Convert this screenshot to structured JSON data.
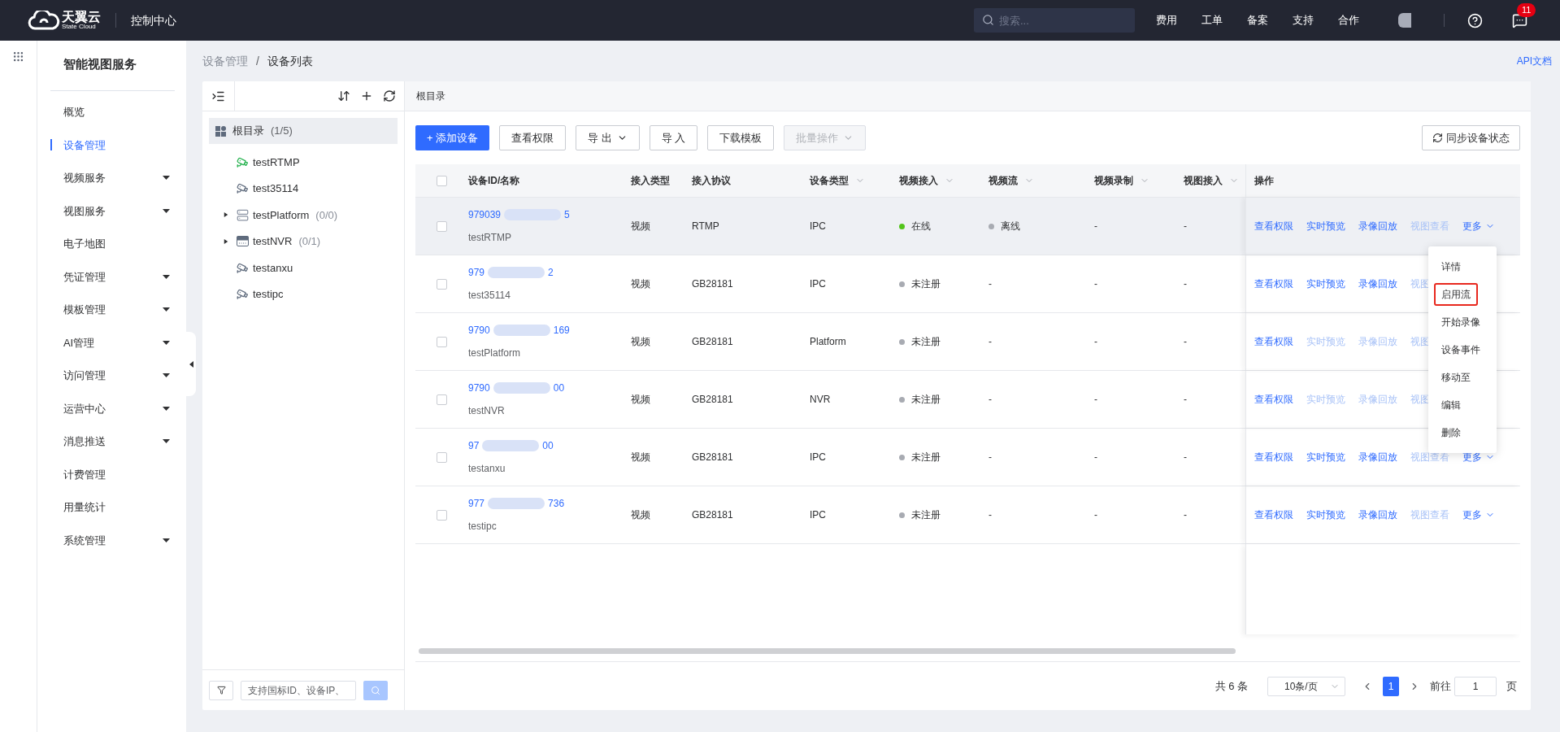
{
  "header": {
    "brand": "天翼云",
    "brand_sub": "State Cloud",
    "console": "控制中心",
    "search": {
      "placeholder": "搜索..."
    },
    "nav": [
      "费用",
      "工单",
      "备案",
      "支持",
      "合作"
    ],
    "badge": "11"
  },
  "sidebar": {
    "title": "智能视图服务",
    "items": [
      {
        "label": "概览",
        "selected": false,
        "expandable": false
      },
      {
        "label": "设备管理",
        "selected": true,
        "expandable": false
      },
      {
        "label": "视频服务",
        "selected": false,
        "expandable": true
      },
      {
        "label": "视图服务",
        "selected": false,
        "expandable": true
      },
      {
        "label": "电子地图",
        "selected": false,
        "expandable": false
      },
      {
        "label": "凭证管理",
        "selected": false,
        "expandable": true
      },
      {
        "label": "模板管理",
        "selected": false,
        "expandable": true
      },
      {
        "label": "AI管理",
        "selected": false,
        "expandable": true
      },
      {
        "label": "访问管理",
        "selected": false,
        "expandable": true
      },
      {
        "label": "运营中心",
        "selected": false,
        "expandable": true
      },
      {
        "label": "消息推送",
        "selected": false,
        "expandable": true
      },
      {
        "label": "计费管理",
        "selected": false,
        "expandable": false
      },
      {
        "label": "用量统计",
        "selected": false,
        "expandable": false
      },
      {
        "label": "系统管理",
        "selected": false,
        "expandable": true
      }
    ]
  },
  "breadcrumb": [
    "设备管理",
    "设备列表"
  ],
  "breadcrumb_separator": "/",
  "api_link": "API文档",
  "tree": {
    "root": {
      "label": "根目录",
      "count": "(1/5)",
      "selected": true,
      "children": [
        {
          "label": "testRTMP",
          "kind": "camera",
          "online": true
        },
        {
          "label": "test35114",
          "kind": "camera",
          "online": false
        },
        {
          "label": "testPlatform",
          "kind": "platform",
          "count": "(0/0)",
          "expanded": false
        },
        {
          "label": "testNVR",
          "kind": "nvr",
          "count": "(0/1)",
          "expanded": false
        },
        {
          "label": "testanxu",
          "kind": "camera",
          "online": false
        },
        {
          "label": "testipc",
          "kind": "camera",
          "online": false
        }
      ]
    },
    "search": {
      "placeholder": "支持国标ID、设备IP、"
    }
  },
  "panel_title": "根目录",
  "toolbar": [
    {
      "label": "+ 添加设备",
      "kind": "primary",
      "disabled": false,
      "dropdown": false
    },
    {
      "label": "查看权限",
      "kind": "default",
      "disabled": false,
      "dropdown": false
    },
    {
      "label": "导 出",
      "kind": "default",
      "disabled": false,
      "dropdown": true
    },
    {
      "label": "导 入",
      "kind": "default",
      "disabled": false,
      "dropdown": false
    },
    {
      "label": "下载模板",
      "kind": "default",
      "disabled": false,
      "dropdown": false
    },
    {
      "label": "批量操作",
      "kind": "default",
      "disabled": true,
      "dropdown": true
    }
  ],
  "sync_button": "同步设备状态",
  "table": {
    "select_all_checked": false,
    "columns": [
      {
        "label": "设备ID/名称",
        "filter": false
      },
      {
        "label": "接入类型",
        "filter": false
      },
      {
        "label": "接入协议",
        "filter": false
      },
      {
        "label": "设备类型",
        "filter": true
      },
      {
        "label": "视频接入",
        "filter": true
      },
      {
        "label": "视频流",
        "filter": true
      },
      {
        "label": "视频录制",
        "filter": true
      },
      {
        "label": "视图接入",
        "filter": true
      },
      {
        "label": "操作",
        "filter": false
      }
    ],
    "rows": [
      {
        "id_head": "979039",
        "id_tail": "5",
        "name": "testRTMP",
        "access_type": "视频",
        "protocol": "RTMP",
        "device_type": "IPC",
        "video_access": {
          "text": "在线",
          "color": "#52c41a"
        },
        "video_stream": {
          "text": "离线",
          "color": "#a8abb2"
        },
        "video_recording": "-",
        "view_access": "-",
        "highlighted": true,
        "checked": false,
        "ops": [
          {
            "label": "查看权限",
            "disabled": false
          },
          {
            "label": "实时预览",
            "disabled": false
          },
          {
            "label": "录像回放",
            "disabled": false
          },
          {
            "label": "视图查看",
            "disabled": true
          }
        ],
        "more": "更多"
      },
      {
        "id_head": "979",
        "id_tail": "2",
        "name": "test35114",
        "access_type": "视频",
        "protocol": "GB28181",
        "device_type": "IPC",
        "video_access": {
          "text": "未注册",
          "color": "#a8abb2"
        },
        "video_stream": {
          "text": "-"
        },
        "video_recording": "-",
        "view_access": "-",
        "highlighted": false,
        "checked": false,
        "ops": [
          {
            "label": "查看权限",
            "disabled": false
          },
          {
            "label": "实时预览",
            "disabled": false
          },
          {
            "label": "录像回放",
            "disabled": false
          },
          {
            "label": "视图",
            "disabled": true
          }
        ]
      },
      {
        "id_head": "9790",
        "id_tail": "169",
        "name": "testPlatform",
        "access_type": "视频",
        "protocol": "GB28181",
        "device_type": "Platform",
        "video_access": {
          "text": "未注册",
          "color": "#a8abb2"
        },
        "video_stream": {
          "text": "-"
        },
        "video_recording": "-",
        "view_access": "-",
        "highlighted": false,
        "checked": false,
        "ops": [
          {
            "label": "查看权限",
            "disabled": false
          },
          {
            "label": "实时预览",
            "disabled": true
          },
          {
            "label": "录像回放",
            "disabled": true
          },
          {
            "label": "视图",
            "disabled": true
          }
        ]
      },
      {
        "id_head": "9790",
        "id_tail": "00",
        "name": "testNVR",
        "access_type": "视频",
        "protocol": "GB28181",
        "device_type": "NVR",
        "video_access": {
          "text": "未注册",
          "color": "#a8abb2"
        },
        "video_stream": {
          "text": "-"
        },
        "video_recording": "-",
        "view_access": "-",
        "highlighted": false,
        "checked": false,
        "ops": [
          {
            "label": "查看权限",
            "disabled": false
          },
          {
            "label": "实时预览",
            "disabled": true
          },
          {
            "label": "录像回放",
            "disabled": true
          },
          {
            "label": "视图",
            "disabled": true
          }
        ]
      },
      {
        "id_head": "97",
        "id_tail": "00",
        "name": "testanxu",
        "access_type": "视频",
        "protocol": "GB28181",
        "device_type": "IPC",
        "video_access": {
          "text": "未注册",
          "color": "#a8abb2"
        },
        "video_stream": {
          "text": "-"
        },
        "video_recording": "-",
        "view_access": "-",
        "highlighted": false,
        "checked": false,
        "ops": [
          {
            "label": "查看权限",
            "disabled": false
          },
          {
            "label": "实时预览",
            "disabled": false
          },
          {
            "label": "录像回放",
            "disabled": false
          },
          {
            "label": "视图查看",
            "disabled": true
          }
        ],
        "more": "更多"
      },
      {
        "id_head": "977",
        "id_tail": "736",
        "name": "testipc",
        "access_type": "视频",
        "protocol": "GB28181",
        "device_type": "IPC",
        "video_access": {
          "text": "未注册",
          "color": "#a8abb2"
        },
        "video_stream": {
          "text": "-"
        },
        "video_recording": "-",
        "view_access": "-",
        "highlighted": false,
        "checked": false,
        "ops": [
          {
            "label": "查看权限",
            "disabled": false
          },
          {
            "label": "实时预览",
            "disabled": false
          },
          {
            "label": "录像回放",
            "disabled": false
          },
          {
            "label": "视图查看",
            "disabled": true
          }
        ],
        "more": "更多"
      }
    ]
  },
  "more_menu": [
    {
      "label": "详情",
      "annotated": false
    },
    {
      "label": "启用流",
      "annotated": true
    },
    {
      "label": "开始录像",
      "annotated": false
    },
    {
      "label": "设备事件",
      "annotated": false
    },
    {
      "label": "移动至",
      "annotated": false
    },
    {
      "label": "编辑",
      "annotated": false
    },
    {
      "label": "删除",
      "annotated": false
    }
  ],
  "pagination": {
    "total": "共 6 条",
    "page_size": "10条/页",
    "pages": [
      {
        "label": "1",
        "selected": true
      }
    ],
    "goto": "前往",
    "goto_value": "1",
    "page_unit": "页"
  }
}
